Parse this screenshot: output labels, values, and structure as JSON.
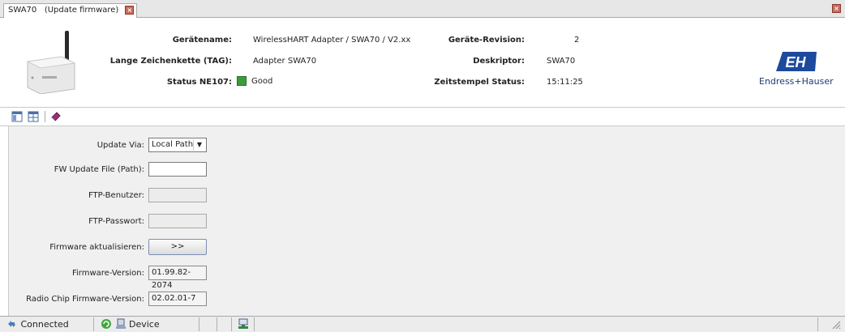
{
  "tab": {
    "title": "SWA70",
    "subtitle": "(Update firmware)"
  },
  "header": {
    "rows": [
      {
        "label": "Gerätename:",
        "value": "WirelessHART Adapter / SWA70 / V2.xx",
        "label2": "Geräte-Revision:",
        "value2": "2"
      },
      {
        "label": "Lange Zeichenkette (TAG):",
        "value": "Adapter SWA70",
        "label2": "Deskriptor:",
        "value2": "SWA70"
      },
      {
        "label": "Status NE107:",
        "value": "Good",
        "label2": "Zeitstempel Status:",
        "value2": "15:11:25"
      }
    ],
    "status_color": "#3a9b3a",
    "logo_text": "Endress+Hauser",
    "logo_mark": "EH"
  },
  "form": {
    "update_via_label": "Update Via:",
    "update_via_value": "Local Path",
    "fw_file_label": "FW Update File (Path):",
    "fw_file_value": "",
    "ftp_user_label": "FTP-Benutzer:",
    "ftp_pass_label": "FTP-Passwort:",
    "fw_update_label": "Firmware aktualisieren:",
    "fw_update_button": ">>",
    "fw_version_label": "Firmware-Version:",
    "fw_version_value": "01.99.82-2074",
    "radio_fw_label": "Radio Chip Firmware-Version:",
    "radio_fw_value": "02.02.01-7"
  },
  "statusbar": {
    "connection": "Connected",
    "device": "Device"
  },
  "colors": {
    "accent": "#1c3b73",
    "status_good": "#3a9b3a"
  }
}
